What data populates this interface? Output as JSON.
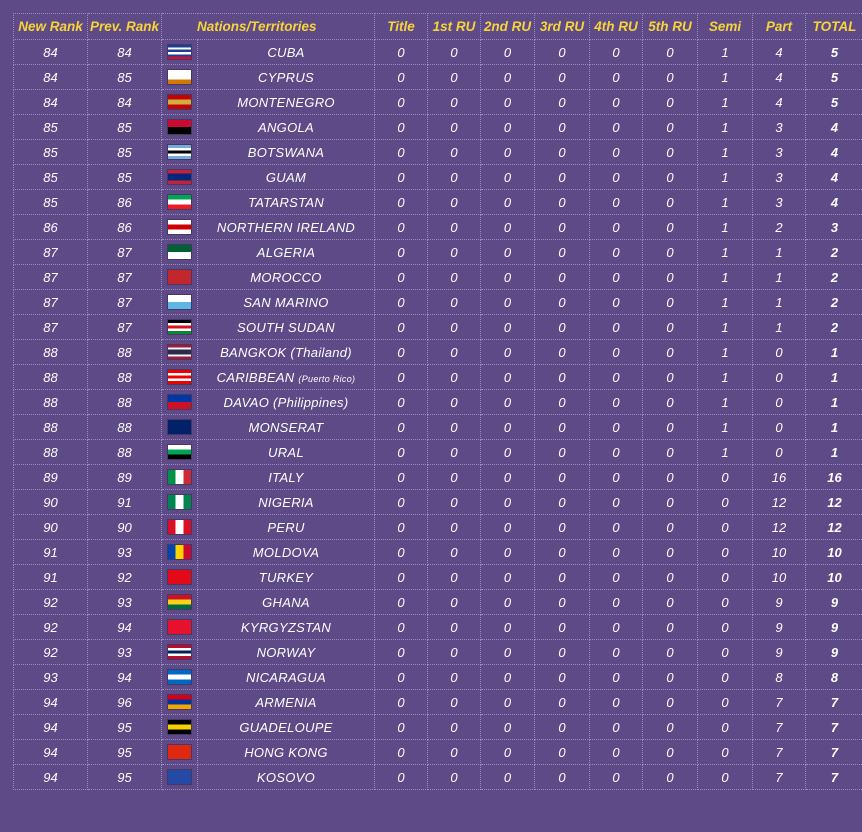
{
  "columns": [
    "New Rank",
    "Prev. Rank",
    "Nations/Territories",
    "Title",
    "1st RU",
    "2nd RU",
    "3rd RU",
    "4th RU",
    "5th RU",
    "Semi",
    "Part",
    "TOTAL"
  ],
  "rows": [
    {
      "new": "84",
      "prev": "84",
      "nation": "CUBA",
      "note": "",
      "flag": [
        "#1c3f95",
        "#ffffff",
        "#1c3f95",
        "#ffffff",
        "#1c3f95",
        "#d21034"
      ],
      "title": "0",
      "ru1": "0",
      "ru2": "0",
      "ru3": "0",
      "ru4": "0",
      "ru5": "0",
      "semi": "1",
      "part": "4",
      "total": "5"
    },
    {
      "new": "84",
      "prev": "85",
      "nation": "CYPRUS",
      "note": "",
      "flag": [
        "#ffffff",
        "#ffffff",
        "#d57800"
      ],
      "title": "0",
      "ru1": "0",
      "ru2": "0",
      "ru3": "0",
      "ru4": "0",
      "ru5": "0",
      "semi": "1",
      "part": "4",
      "total": "5"
    },
    {
      "new": "84",
      "prev": "84",
      "nation": "MONTENEGRO",
      "note": "",
      "flag": [
        "#c40308",
        "#d3ae3b",
        "#c40308"
      ],
      "title": "0",
      "ru1": "0",
      "ru2": "0",
      "ru3": "0",
      "ru4": "0",
      "ru5": "0",
      "semi": "1",
      "part": "4",
      "total": "5"
    },
    {
      "new": "85",
      "prev": "85",
      "nation": "ANGOLA",
      "note": "",
      "flag": [
        "#cc092f",
        "#000000"
      ],
      "title": "0",
      "ru1": "0",
      "ru2": "0",
      "ru3": "0",
      "ru4": "0",
      "ru5": "0",
      "semi": "1",
      "part": "3",
      "total": "4"
    },
    {
      "new": "85",
      "prev": "85",
      "nation": "BOTSWANA",
      "note": "",
      "flag": [
        "#75aadb",
        "#ffffff",
        "#000000",
        "#ffffff",
        "#75aadb"
      ],
      "title": "0",
      "ru1": "0",
      "ru2": "0",
      "ru3": "0",
      "ru4": "0",
      "ru5": "0",
      "semi": "1",
      "part": "3",
      "total": "4"
    },
    {
      "new": "85",
      "prev": "85",
      "nation": "GUAM",
      "note": "",
      "flag": [
        "#c62139",
        "#00297b",
        "#00297b",
        "#c62139"
      ],
      "title": "0",
      "ru1": "0",
      "ru2": "0",
      "ru3": "0",
      "ru4": "0",
      "ru5": "0",
      "semi": "1",
      "part": "3",
      "total": "4"
    },
    {
      "new": "85",
      "prev": "86",
      "nation": "TATARSTAN",
      "note": "",
      "flag": [
        "#00a651",
        "#ffffff",
        "#ed1c24"
      ],
      "title": "0",
      "ru1": "0",
      "ru2": "0",
      "ru3": "0",
      "ru4": "0",
      "ru5": "0",
      "semi": "1",
      "part": "3",
      "total": "4"
    },
    {
      "new": "86",
      "prev": "86",
      "nation": "NORTHERN IRELAND",
      "note": "",
      "flag": [
        "#ffffff",
        "#cc0000",
        "#ffffff"
      ],
      "title": "0",
      "ru1": "0",
      "ru2": "0",
      "ru3": "0",
      "ru4": "0",
      "ru5": "0",
      "semi": "1",
      "part": "2",
      "total": "3"
    },
    {
      "new": "87",
      "prev": "87",
      "nation": "ALGERIA",
      "note": "",
      "flag": [
        "#006233",
        "#ffffff"
      ],
      "title": "0",
      "ru1": "0",
      "ru2": "0",
      "ru3": "0",
      "ru4": "0",
      "ru5": "0",
      "semi": "1",
      "part": "1",
      "total": "2"
    },
    {
      "new": "87",
      "prev": "87",
      "nation": "MOROCCO",
      "note": "",
      "flag": [
        "#c1272d",
        "#c1272d"
      ],
      "title": "0",
      "ru1": "0",
      "ru2": "0",
      "ru3": "0",
      "ru4": "0",
      "ru5": "0",
      "semi": "1",
      "part": "1",
      "total": "2"
    },
    {
      "new": "87",
      "prev": "87",
      "nation": "SAN MARINO",
      "note": "",
      "flag": [
        "#ffffff",
        "#5eb6e4"
      ],
      "title": "0",
      "ru1": "0",
      "ru2": "0",
      "ru3": "0",
      "ru4": "0",
      "ru5": "0",
      "semi": "1",
      "part": "1",
      "total": "2"
    },
    {
      "new": "87",
      "prev": "87",
      "nation": "SOUTH SUDAN",
      "note": "",
      "flag": [
        "#000000",
        "#ffffff",
        "#da121a",
        "#ffffff",
        "#078930"
      ],
      "title": "0",
      "ru1": "0",
      "ru2": "0",
      "ru3": "0",
      "ru4": "0",
      "ru5": "0",
      "semi": "1",
      "part": "1",
      "total": "2"
    },
    {
      "new": "88",
      "prev": "88",
      "nation": "BANGKOK (Thailand)",
      "note": "",
      "flag": [
        "#a51931",
        "#f4f5f8",
        "#2d2a4a",
        "#2d2a4a",
        "#f4f5f8",
        "#a51931"
      ],
      "title": "0",
      "ru1": "0",
      "ru2": "0",
      "ru3": "0",
      "ru4": "0",
      "ru5": "0",
      "semi": "1",
      "part": "0",
      "total": "1"
    },
    {
      "new": "88",
      "prev": "88",
      "nation": "CARIBBEAN",
      "note": "(Puerto Rico)",
      "flag": [
        "#ed0000",
        "#ffffff",
        "#ed0000",
        "#ffffff",
        "#ed0000"
      ],
      "title": "0",
      "ru1": "0",
      "ru2": "0",
      "ru3": "0",
      "ru4": "0",
      "ru5": "0",
      "semi": "1",
      "part": "0",
      "total": "1"
    },
    {
      "new": "88",
      "prev": "88",
      "nation": "DAVAO (Philippines)",
      "note": "",
      "flag": [
        "#0038a8",
        "#ce1126"
      ],
      "title": "0",
      "ru1": "0",
      "ru2": "0",
      "ru3": "0",
      "ru4": "0",
      "ru5": "0",
      "semi": "1",
      "part": "0",
      "total": "1"
    },
    {
      "new": "88",
      "prev": "88",
      "nation": "MONSERAT",
      "note": "",
      "flag": [
        "#012169",
        "#012169"
      ],
      "title": "0",
      "ru1": "0",
      "ru2": "0",
      "ru3": "0",
      "ru4": "0",
      "ru5": "0",
      "semi": "1",
      "part": "0",
      "total": "1"
    },
    {
      "new": "88",
      "prev": "88",
      "nation": "URAL",
      "note": "",
      "flag": [
        "#ffffff",
        "#00a651",
        "#000000"
      ],
      "title": "0",
      "ru1": "0",
      "ru2": "0",
      "ru3": "0",
      "ru4": "0",
      "ru5": "0",
      "semi": "1",
      "part": "0",
      "total": "1"
    },
    {
      "new": "89",
      "prev": "89",
      "nation": "ITALY",
      "note": "",
      "flag": [
        "#009246",
        "#ffffff",
        "#ce2b37"
      ],
      "flag_dir": "v",
      "title": "0",
      "ru1": "0",
      "ru2": "0",
      "ru3": "0",
      "ru4": "0",
      "ru5": "0",
      "semi": "0",
      "part": "16",
      "total": "16"
    },
    {
      "new": "90",
      "prev": "91",
      "nation": "NIGERIA",
      "note": "",
      "flag": [
        "#008751",
        "#ffffff",
        "#008751"
      ],
      "flag_dir": "v",
      "title": "0",
      "ru1": "0",
      "ru2": "0",
      "ru3": "0",
      "ru4": "0",
      "ru5": "0",
      "semi": "0",
      "part": "12",
      "total": "12"
    },
    {
      "new": "90",
      "prev": "90",
      "nation": "PERU",
      "note": "",
      "flag": [
        "#d91023",
        "#ffffff",
        "#d91023"
      ],
      "flag_dir": "v",
      "title": "0",
      "ru1": "0",
      "ru2": "0",
      "ru3": "0",
      "ru4": "0",
      "ru5": "0",
      "semi": "0",
      "part": "12",
      "total": "12"
    },
    {
      "new": "91",
      "prev": "93",
      "nation": "MOLDOVA",
      "note": "",
      "flag": [
        "#0046ae",
        "#ffd200",
        "#cc092f"
      ],
      "flag_dir": "v",
      "title": "0",
      "ru1": "0",
      "ru2": "0",
      "ru3": "0",
      "ru4": "0",
      "ru5": "0",
      "semi": "0",
      "part": "10",
      "total": "10"
    },
    {
      "new": "91",
      "prev": "92",
      "nation": "TURKEY",
      "note": "",
      "flag": [
        "#e30a17",
        "#e30a17"
      ],
      "title": "0",
      "ru1": "0",
      "ru2": "0",
      "ru3": "0",
      "ru4": "0",
      "ru5": "0",
      "semi": "0",
      "part": "10",
      "total": "10"
    },
    {
      "new": "92",
      "prev": "93",
      "nation": "GHANA",
      "note": "",
      "flag": [
        "#ce1126",
        "#fcd116",
        "#006b3f"
      ],
      "title": "0",
      "ru1": "0",
      "ru2": "0",
      "ru3": "0",
      "ru4": "0",
      "ru5": "0",
      "semi": "0",
      "part": "9",
      "total": "9"
    },
    {
      "new": "92",
      "prev": "94",
      "nation": "KYRGYZSTAN",
      "note": "",
      "flag": [
        "#e8112d",
        "#e8112d"
      ],
      "title": "0",
      "ru1": "0",
      "ru2": "0",
      "ru3": "0",
      "ru4": "0",
      "ru5": "0",
      "semi": "0",
      "part": "9",
      "total": "9"
    },
    {
      "new": "92",
      "prev": "93",
      "nation": "NORWAY",
      "note": "",
      "flag": [
        "#ba0c2f",
        "#ffffff",
        "#00205b",
        "#ffffff",
        "#ba0c2f"
      ],
      "title": "0",
      "ru1": "0",
      "ru2": "0",
      "ru3": "0",
      "ru4": "0",
      "ru5": "0",
      "semi": "0",
      "part": "9",
      "total": "9"
    },
    {
      "new": "93",
      "prev": "94",
      "nation": "NICARAGUA",
      "note": "",
      "flag": [
        "#0067c6",
        "#ffffff",
        "#0067c6"
      ],
      "title": "0",
      "ru1": "0",
      "ru2": "0",
      "ru3": "0",
      "ru4": "0",
      "ru5": "0",
      "semi": "0",
      "part": "8",
      "total": "8"
    },
    {
      "new": "94",
      "prev": "96",
      "nation": "ARMENIA",
      "note": "",
      "flag": [
        "#d90012",
        "#0033a0",
        "#f2a800"
      ],
      "title": "0",
      "ru1": "0",
      "ru2": "0",
      "ru3": "0",
      "ru4": "0",
      "ru5": "0",
      "semi": "0",
      "part": "7",
      "total": "7"
    },
    {
      "new": "94",
      "prev": "95",
      "nation": "GUADELOUPE",
      "note": "",
      "flag": [
        "#000000",
        "#f6d100",
        "#000000"
      ],
      "title": "0",
      "ru1": "0",
      "ru2": "0",
      "ru3": "0",
      "ru4": "0",
      "ru5": "0",
      "semi": "0",
      "part": "7",
      "total": "7"
    },
    {
      "new": "94",
      "prev": "95",
      "nation": "HONG KONG",
      "note": "",
      "flag": [
        "#de2910",
        "#de2910"
      ],
      "title": "0",
      "ru1": "0",
      "ru2": "0",
      "ru3": "0",
      "ru4": "0",
      "ru5": "0",
      "semi": "0",
      "part": "7",
      "total": "7"
    },
    {
      "new": "94",
      "prev": "95",
      "nation": "KOSOVO",
      "note": "",
      "flag": [
        "#244aa5",
        "#244aa5"
      ],
      "title": "0",
      "ru1": "0",
      "ru2": "0",
      "ru3": "0",
      "ru4": "0",
      "ru5": "0",
      "semi": "0",
      "part": "7",
      "total": "7"
    }
  ]
}
